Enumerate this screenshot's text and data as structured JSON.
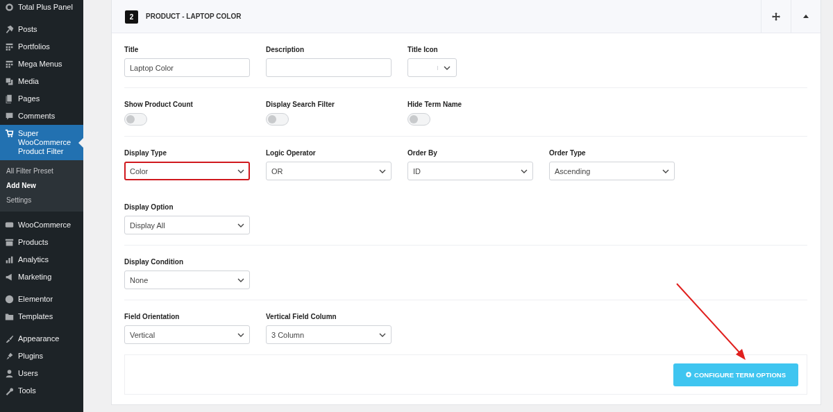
{
  "sidebar": {
    "groups": [
      {
        "items": [
          {
            "label": "Total Plus Panel",
            "selected": false
          }
        ]
      },
      {
        "items": [
          {
            "label": "Posts",
            "selected": false
          },
          {
            "label": "Portfolios",
            "selected": false
          },
          {
            "label": "Mega Menus",
            "selected": false
          },
          {
            "label": "Media",
            "selected": false
          },
          {
            "label": "Pages",
            "selected": false
          },
          {
            "label": "Comments",
            "selected": false
          },
          {
            "label": "Super WooCommerce Product Filter",
            "selected": true,
            "submenu": [
              {
                "label": "All Filter Preset",
                "selected": false
              },
              {
                "label": "Add New",
                "selected": true
              },
              {
                "label": "Settings",
                "selected": false
              }
            ]
          }
        ]
      },
      {
        "items": [
          {
            "label": "WooCommerce",
            "selected": false
          },
          {
            "label": "Products",
            "selected": false
          },
          {
            "label": "Analytics",
            "selected": false
          },
          {
            "label": "Marketing",
            "selected": false
          }
        ]
      },
      {
        "items": [
          {
            "label": "Elementor",
            "selected": false
          },
          {
            "label": "Templates",
            "selected": false
          }
        ]
      },
      {
        "items": [
          {
            "label": "Appearance",
            "selected": false
          },
          {
            "label": "Plugins",
            "selected": false
          },
          {
            "label": "Users",
            "selected": false
          },
          {
            "label": "Tools",
            "selected": false
          }
        ]
      }
    ]
  },
  "panel": {
    "number": "2",
    "title": "PRODUCT - LAPTOP COLOR",
    "expanded": true,
    "rows": [
      {
        "divider": true,
        "fields": [
          {
            "kind": "text",
            "label": "Title",
            "value": "Laptop Color"
          },
          {
            "kind": "text",
            "label": "Description"
          },
          {
            "kind": "icon-select",
            "label": "Title Icon"
          }
        ]
      },
      {
        "divider": true,
        "fields": [
          {
            "kind": "toggle",
            "label": "Show Product Count",
            "on": false
          },
          {
            "kind": "toggle",
            "label": "Display Search Filter",
            "on": false
          },
          {
            "kind": "toggle",
            "label": "Hide Term Name",
            "on": false
          }
        ]
      },
      {
        "divider": false,
        "fields": [
          {
            "kind": "select",
            "label": "Display Type",
            "value": "Color",
            "highlighted": true
          },
          {
            "kind": "select",
            "label": "Logic Operator",
            "value": "OR",
            "highlighted": false
          },
          {
            "kind": "select",
            "label": "Order By",
            "value": "ID",
            "highlighted": false
          },
          {
            "kind": "select",
            "label": "Order Type",
            "value": "Ascending",
            "highlighted": false
          }
        ]
      },
      {
        "divider": true,
        "fields": [
          {
            "kind": "select",
            "label": "Display Option",
            "value": "Display All",
            "highlighted": false
          }
        ]
      },
      {
        "divider": true,
        "fields": [
          {
            "kind": "select",
            "label": "Display Condition",
            "value": "None",
            "highlighted": false
          }
        ]
      },
      {
        "divider": false,
        "fields": [
          {
            "kind": "select",
            "label": "Field Orientation",
            "value": "Vertical",
            "highlighted": false
          },
          {
            "kind": "select",
            "label": "Vertical Field Column",
            "value": "3 Column",
            "highlighted": false
          }
        ]
      }
    ],
    "button": "CONFIGURE TERM OPTIONS"
  }
}
